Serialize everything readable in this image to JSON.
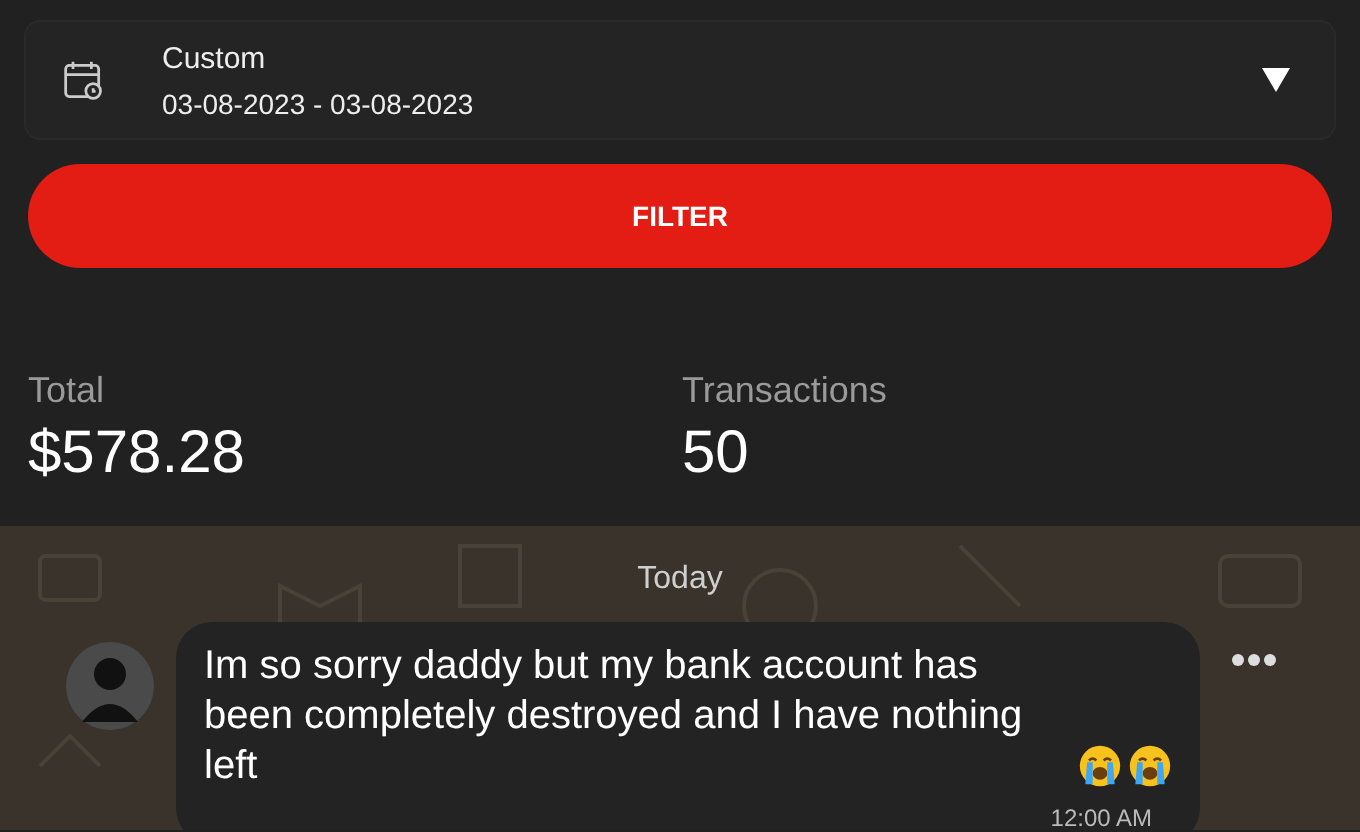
{
  "date_filter": {
    "label": "Custom",
    "range": "03-08-2023 - 03-08-2023"
  },
  "filter_button": "FILTER",
  "stats": [
    {
      "label": "Total",
      "value": "$578.28"
    },
    {
      "label": "Transactions",
      "value": "50"
    }
  ],
  "chat": {
    "day": "Today",
    "message": {
      "text": "Im so sorry daddy but my bank account has been completely destroyed and I have nothing left",
      "time": "12:00 AM"
    }
  }
}
